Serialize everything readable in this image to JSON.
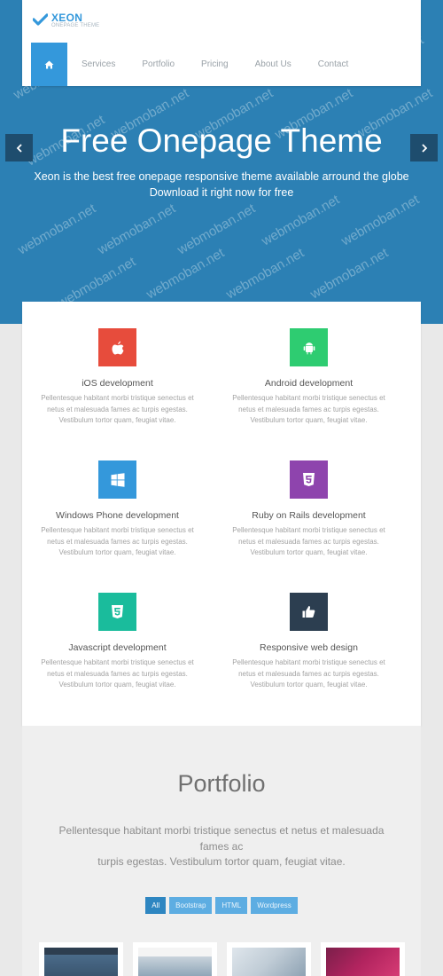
{
  "brand": {
    "name": "XEON",
    "tagline": "ONEPAGE THEME"
  },
  "nav": {
    "home_icon": "home-icon",
    "items": [
      "Services",
      "Portfolio",
      "Pricing",
      "About Us",
      "Contact"
    ]
  },
  "hero": {
    "title": "Free Onepage Theme",
    "line1": "Xeon is the best free onepage responsive theme available arround the globe",
    "line2": "Download it right now for free"
  },
  "watermark": "webmoban.net",
  "services": [
    {
      "title": "iOS development",
      "icon": "apple-icon",
      "color": "#e74c3c",
      "text": [
        "Pellentesque habitant morbi tristique senectus et",
        "netus et malesuada fames ac turpis egestas.",
        "Vestibulum tortor quam, feugiat vitae."
      ]
    },
    {
      "title": "Android development",
      "icon": "android-icon",
      "color": "#2ecc71",
      "text": [
        "Pellentesque habitant morbi tristique senectus et",
        "netus et malesuada fames ac turpis egestas.",
        "Vestibulum tortor quam, feugiat vitae."
      ]
    },
    {
      "title": "Windows Phone development",
      "icon": "windows-icon",
      "color": "#3498db",
      "text": [
        "Pellentesque habitant morbi tristique senectus et",
        "netus et malesuada fames ac turpis egestas.",
        "Vestibulum tortor quam, feugiat vitae."
      ]
    },
    {
      "title": "Ruby on Rails development",
      "icon": "html5-icon",
      "color": "#8e44ad",
      "text": [
        "Pellentesque habitant morbi tristique senectus et",
        "netus et malesuada fames ac turpis egestas.",
        "Vestibulum tortor quam, feugiat vitae."
      ]
    },
    {
      "title": "Javascript development",
      "icon": "css3-icon",
      "color": "#1abc9c",
      "text": [
        "Pellentesque habitant morbi tristique senectus et",
        "netus et malesuada fames ac turpis egestas.",
        "Vestibulum tortor quam, feugiat vitae."
      ]
    },
    {
      "title": "Responsive web design",
      "icon": "thumbs-up-icon",
      "color": "#2c3e50",
      "text": [
        "Pellentesque habitant morbi tristique senectus et",
        "netus et malesuada fames ac turpis egestas.",
        "Vestibulum tortor quam, feugiat vitae."
      ]
    }
  ],
  "portfolio": {
    "title": "Portfolio",
    "desc_line1": "Pellentesque habitant morbi tristique senectus et netus et malesuada",
    "desc_line2": "fames ac",
    "desc_line3": "turpis egestas. Vestibulum tortor quam, feugiat vitae.",
    "filters": [
      "All",
      "Bootstrap",
      "HTML",
      "Wordpress"
    ],
    "active_filter": "All"
  },
  "colors": {
    "accent": "#3498db",
    "hero_bg": "#2c80b4",
    "nav_text": "#9aa2a8"
  }
}
